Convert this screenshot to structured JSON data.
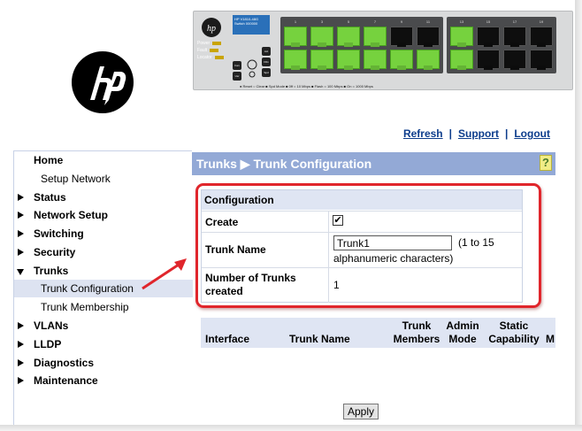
{
  "panel": {
    "model_text": "HP V1810-48G Switch 000000",
    "leds": [
      "Power",
      "Fault",
      "Locator"
    ],
    "controls": [
      "Act",
      "FDx",
      "Spd",
      "Fan",
      "Usr"
    ],
    "legend": "● Reset  ○ Clear   ■ Spd Mode  ■ 0ff = 10 Mbps  ■ Flash = 100 Mbps  ■ On = 1000 Mbps",
    "port_group_1_labels": [
      "1",
      "3",
      "5",
      "7",
      "9",
      "11"
    ],
    "port_group_2_labels": [
      "13",
      "15",
      "17",
      "19"
    ]
  },
  "toplinks": {
    "refresh": "Refresh",
    "support": "Support",
    "logout": "Logout",
    "separator": "|"
  },
  "nav": {
    "home": "Home",
    "setup_network": "Setup Network",
    "status": "Status",
    "network_setup": "Network Setup",
    "switching": "Switching",
    "security": "Security",
    "trunks": "Trunks",
    "trunk_configuration": "Trunk Configuration",
    "trunk_membership": "Trunk Membership",
    "vlans": "VLANs",
    "lldp": "LLDP",
    "diagnostics": "Diagnostics",
    "maintenance": "Maintenance"
  },
  "page": {
    "title": "Trunks ▶ Trunk Configuration",
    "help": "?"
  },
  "config": {
    "heading": "Configuration",
    "create_label": "Create",
    "create_checked": "✔",
    "trunk_name_label": "Trunk Name",
    "trunk_name_value": "Trunk1",
    "trunk_name_hint_1": "(1 to 15",
    "trunk_name_hint_2": "alphanumeric characters)",
    "num_trunks_label_1": "Number of Trunks",
    "num_trunks_label_2": "created",
    "num_trunks_value": "1"
  },
  "table": {
    "col_interface": "Interface",
    "col_trunk_name": "Trunk Name",
    "col_trunk_members_1": "Trunk",
    "col_trunk_members_2": "Members",
    "col_admin_mode_1": "Admin",
    "col_admin_mode_2": "Mode",
    "col_static_cap_1": "Static",
    "col_static_cap_2": "Capability",
    "col_cut_off": "M"
  },
  "apply_label": "Apply",
  "colors": {
    "header_blue": "#93a9d6",
    "light_blue": "#dfe5f3",
    "link_blue": "#0d3d8c",
    "annotation_red": "#e0262c",
    "port_green": "#76d23e"
  }
}
